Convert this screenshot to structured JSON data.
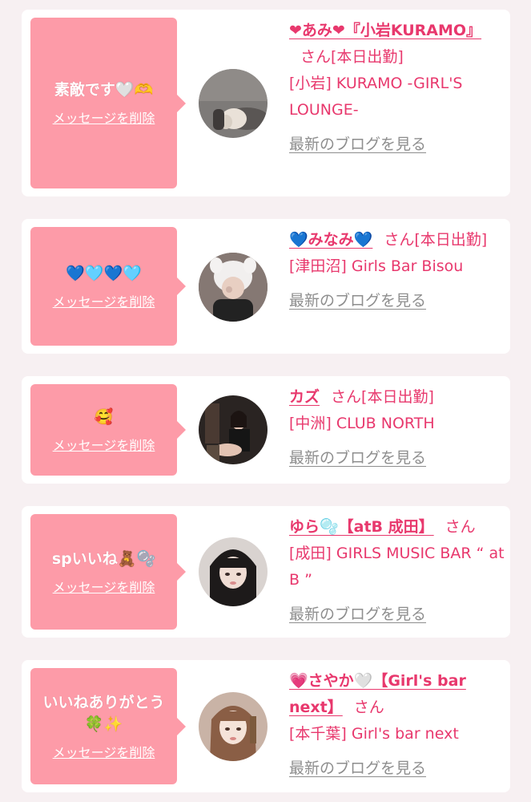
{
  "colors": {
    "accent": "#e8386d",
    "bubble": "#fd9ba8",
    "link_gray": "#8e8e8e",
    "background": "#f7f0f2"
  },
  "cards": [
    {
      "message": "素敵です🤍🫶",
      "delete_label": "メッセージを削除",
      "name": "❤あみ❤『小岩KURAMO』",
      "honorific": "さん",
      "status": "[本日出勤]",
      "shop": "[小岩] KURAMO -GIRL'S LOUNGE-",
      "blog_label": "最新のブログを見る"
    },
    {
      "message": "💙🩵💙🩵",
      "delete_label": "メッセージを削除",
      "name": "💙みなみ💙",
      "honorific": "さん",
      "status": "[本日出勤]",
      "shop": "[津田沼] Girls Bar Bisou",
      "blog_label": "最新のブログを見る"
    },
    {
      "message": "🥰",
      "delete_label": "メッセージを削除",
      "name": "カズ",
      "honorific": "さん",
      "status": "[本日出勤]",
      "shop": "[中洲] CLUB NORTH",
      "blog_label": "最新のブログを見る"
    },
    {
      "message": "spいいね🧸🫧",
      "delete_label": "メッセージを削除",
      "name": "ゆら🫧【atB 成田】",
      "honorific": "さん",
      "status": "",
      "shop": "[成田] GIRLS MUSIC BAR “ at B ”",
      "blog_label": "最新のブログを見る"
    },
    {
      "message": "いいねありがとう🍀✨",
      "delete_label": "メッセージを削除",
      "name": "💗さやか🤍【Girl's bar next】",
      "honorific": "さん",
      "status": "",
      "shop": "[本千葉] Girl's bar next",
      "blog_label": "最新のブログを見る"
    }
  ]
}
